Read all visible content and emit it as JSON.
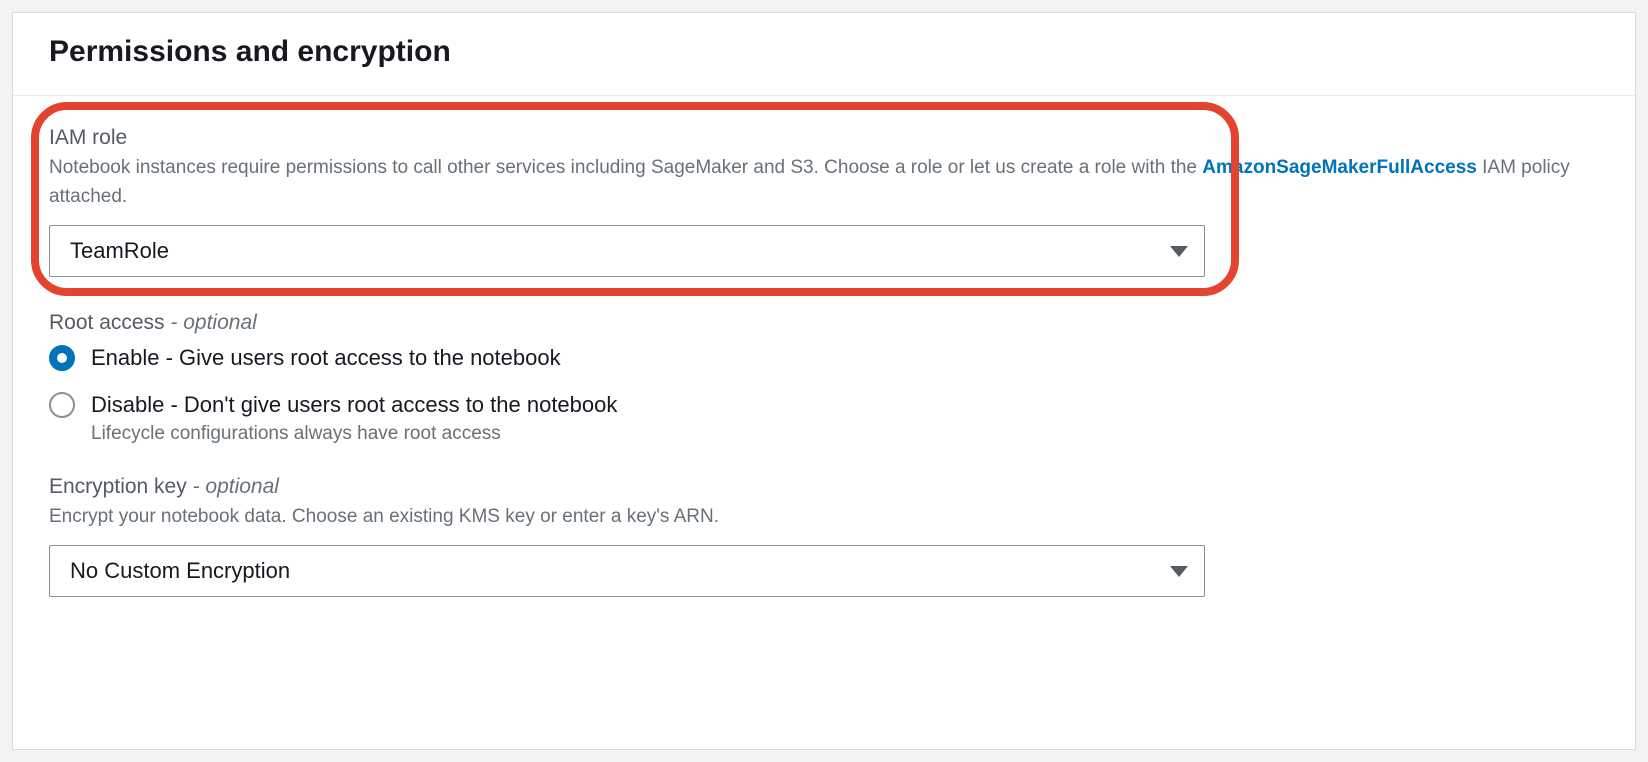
{
  "panel": {
    "title": "Permissions and encryption"
  },
  "iamRole": {
    "label": "IAM role",
    "descriptionPre": "Notebook instances require permissions to call other services including SageMaker and S3. Choose a role or let us create a role with the ",
    "linkText": "AmazonSageMakerFullAccess",
    "descriptionPost": " IAM policy attached.",
    "selected": "TeamRole"
  },
  "rootAccess": {
    "label": "Root access",
    "optional": " - optional",
    "options": {
      "enable": {
        "text": "Enable - Give users root access to the notebook",
        "selected": true
      },
      "disable": {
        "text": "Disable - Don't give users root access to the notebook",
        "subtext": "Lifecycle configurations always have root access",
        "selected": false
      }
    }
  },
  "encryptionKey": {
    "label": "Encryption key",
    "optional": " - optional",
    "description": "Encrypt your notebook data. Choose an existing KMS key or enter a key's ARN.",
    "selected": "No Custom Encryption"
  }
}
